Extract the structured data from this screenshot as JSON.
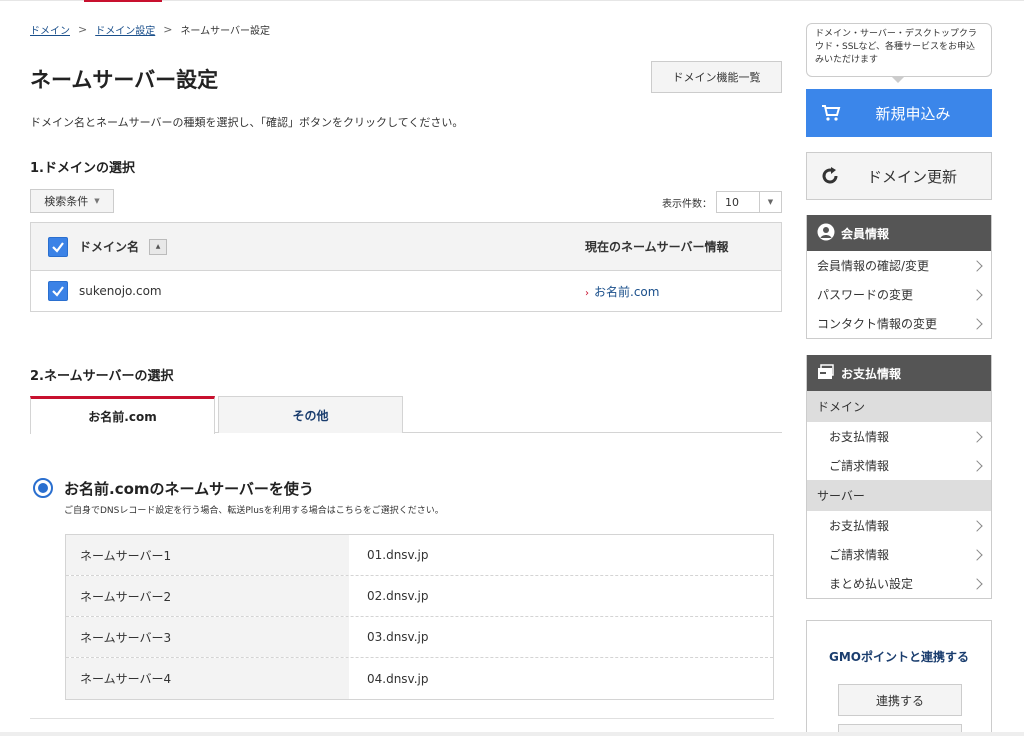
{
  "breadcrumb": {
    "item1": "ドメイン",
    "item2": "ドメイン設定",
    "current": "ネームサーバー設定",
    "sep": ">"
  },
  "page": {
    "title": "ネームサーバー設定",
    "func_list_label": "ドメイン機能一覧",
    "lead": "ドメイン名とネームサーバーの種類を選択し、「確認」ボタンをクリックしてください。"
  },
  "section1": {
    "title": "1.ドメインの選択",
    "search_label": "検索条件",
    "count_label": "表示件数：",
    "count_value": "10",
    "table": {
      "col_domain": "ドメイン名",
      "col_ns": "現在のネームサーバー情報",
      "rows": [
        {
          "domain": "sukenojo.com",
          "ns": "お名前.com",
          "checked": true
        }
      ]
    }
  },
  "section2": {
    "title": "2.ネームサーバーの選択",
    "tabs": [
      {
        "label": "お名前.com",
        "active": true
      },
      {
        "label": "その他",
        "active": false
      }
    ],
    "option_label": "お名前.comのネームサーバーを使う",
    "option_note": "ご自身でDNSレコード設定を行う場合、転送Plusを利用する場合はこちらをご選択ください。",
    "nameservers": [
      {
        "label": "ネームサーバー1",
        "value": "01.dnsv.jp"
      },
      {
        "label": "ネームサーバー2",
        "value": "02.dnsv.jp"
      },
      {
        "label": "ネームサーバー3",
        "value": "03.dnsv.jp"
      },
      {
        "label": "ネームサーバー4",
        "value": "04.dnsv.jp"
      }
    ]
  },
  "sidebar": {
    "bubble": "ドメイン・サーバー・デスクトップクラウド・SSLなど、各種サービスをお申込みいただけます",
    "new_label": "新規申込み",
    "renew_label": "ドメイン更新",
    "member": {
      "title": "会員情報",
      "items": [
        "会員情報の確認/変更",
        "パスワードの変更",
        "コンタクト情報の変更"
      ]
    },
    "payment": {
      "title": "お支払情報",
      "group_domain": "ドメイン",
      "domain_items": [
        "お支払情報",
        "ご請求情報"
      ],
      "group_server": "サーバー",
      "server_items": [
        "お支払情報",
        "ご請求情報",
        "まとめ払い設定"
      ]
    },
    "gmo": {
      "title": "GMOポイントと連携する",
      "button": "連携する"
    }
  },
  "colors": {
    "accent_red": "#c8102e",
    "primary_blue": "#3b86ea",
    "panel_dark": "#555555"
  },
  "icons": [
    "cart-icon",
    "refresh-icon",
    "user-icon",
    "wallet-icon",
    "check-icon",
    "chevron-right-icon"
  ]
}
